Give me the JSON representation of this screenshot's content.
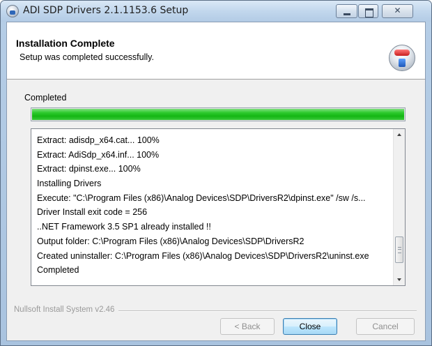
{
  "window": {
    "title": "ADI SDP Drivers 2.1.1153.6 Setup",
    "controls": {
      "minimize": "",
      "maximize": "",
      "close": "✕"
    }
  },
  "header": {
    "title": "Installation Complete",
    "subtitle": "Setup was completed successfully."
  },
  "status": {
    "label": "Completed",
    "progress_percent": 100,
    "progress_color": "#14b614"
  },
  "log": {
    "lines": [
      "Extract: adisdp_x64.cat... 100%",
      "Extract: AdiSdp_x64.inf... 100%",
      "Extract: dpinst.exe... 100%",
      "Installing Drivers",
      "Execute: \"C:\\Program Files (x86)\\Analog Devices\\SDP\\DriversR2\\dpinst.exe\" /sw /s...",
      "Driver Install exit code = 256",
      "..NET Framework 3.5 SP1 already installed !!",
      "Output folder: C:\\Program Files (x86)\\Analog Devices\\SDP\\DriversR2",
      "Created uninstaller: C:\\Program Files (x86)\\Analog Devices\\SDP\\DriversR2\\uninst.exe",
      "Completed"
    ]
  },
  "footer": {
    "branding": "Nullsoft Install System v2.46",
    "buttons": {
      "back": "< Back",
      "close": "Close",
      "cancel": "Cancel"
    }
  }
}
